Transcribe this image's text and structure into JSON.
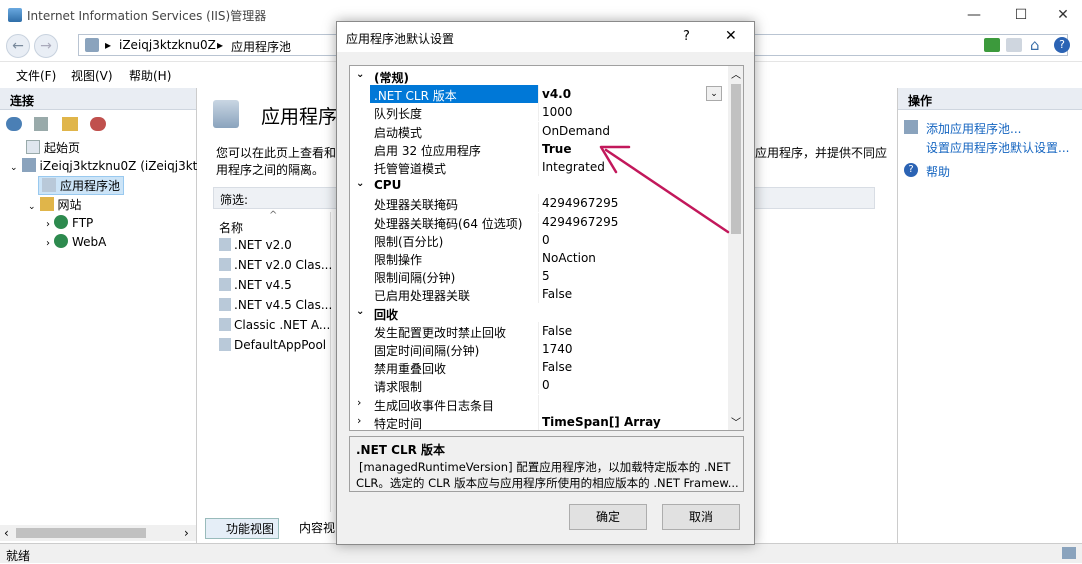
{
  "window": {
    "title": "Internet Information Services (IIS)管理器",
    "minimize": "—",
    "maximize": "☐",
    "close": "✕"
  },
  "address": {
    "server": "iZeiqj3ktzknu0Z",
    "node": "应用程序池"
  },
  "menu": [
    "文件(F)",
    "视图(V)",
    "帮助(H)"
  ],
  "left": {
    "title": "连接",
    "tree": [
      {
        "label": "起始页"
      },
      {
        "label": "iZeiqj3ktzknu0Z (iZeiqj3ktzl"
      },
      {
        "label": "应用程序池"
      },
      {
        "label": "网站"
      },
      {
        "label": "FTP"
      },
      {
        "label": "WebA"
      }
    ]
  },
  "center": {
    "title": "应用程序池",
    "desc1": "您可以在此页上查看和",
    "desc2": "用程序之间的隔离。",
    "desc_right1": "应用程序，并提供不同应",
    "filter": "筛选:",
    "column": "名称",
    "pools": [
      ".NET v2.0",
      ".NET v2.0 Clas...",
      ".NET v4.5",
      ".NET v4.5 Clas...",
      "Classic .NET A...",
      "DefaultAppPool"
    ],
    "view_tabs": [
      "功能视图",
      "内容视"
    ]
  },
  "right": {
    "title": "操作",
    "actions": [
      "添加应用程序池...",
      "设置应用程序池默认设置...",
      "帮助"
    ]
  },
  "status": {
    "text": "就绪"
  },
  "dialog": {
    "title": "应用程序池默认设置",
    "help": "?",
    "close": "✕",
    "categories": {
      "general": "(常规)",
      "cpu": "CPU",
      "recycle": "回收"
    },
    "general": [
      {
        "k": ".NET CLR 版本",
        "v": "v4.0"
      },
      {
        "k": "队列长度",
        "v": "1000"
      },
      {
        "k": "启动模式",
        "v": "OnDemand"
      },
      {
        "k": "启用 32 位应用程序",
        "v": "True"
      },
      {
        "k": "托管管道模式",
        "v": "Integrated"
      }
    ],
    "cpu": [
      {
        "k": "处理器关联掩码",
        "v": "4294967295"
      },
      {
        "k": "处理器关联掩码(64 位选项)",
        "v": "4294967295"
      },
      {
        "k": "限制(百分比)",
        "v": "0"
      },
      {
        "k": "限制操作",
        "v": "NoAction"
      },
      {
        "k": "限制间隔(分钟)",
        "v": "5"
      },
      {
        "k": "已启用处理器关联",
        "v": "False"
      }
    ],
    "recycle": [
      {
        "k": "发生配置更改时禁止回收",
        "v": "False"
      },
      {
        "k": "固定时间间隔(分钟)",
        "v": "1740"
      },
      {
        "k": "禁用重叠回收",
        "v": "False"
      },
      {
        "k": "请求限制",
        "v": "0"
      },
      {
        "k": "生成回收事件日志条目",
        "v": ""
      },
      {
        "k": "特定时间",
        "v": "TimeSpan[] Array"
      }
    ],
    "desc_title": ".NET CLR 版本",
    "desc_text1": "[managedRuntimeVersion] 配置应用程序池，以加载特定版本的 .NET",
    "desc_text2": "CLR。选定的 CLR 版本应与应用程序所使用的相应版本的 .NET Framew...",
    "ok": "确定",
    "cancel": "取消"
  },
  "colors": {
    "accent": "#0078d7",
    "selected_row": "#0078d7",
    "arrow": "#c2185b",
    "link": "#1565c0"
  }
}
